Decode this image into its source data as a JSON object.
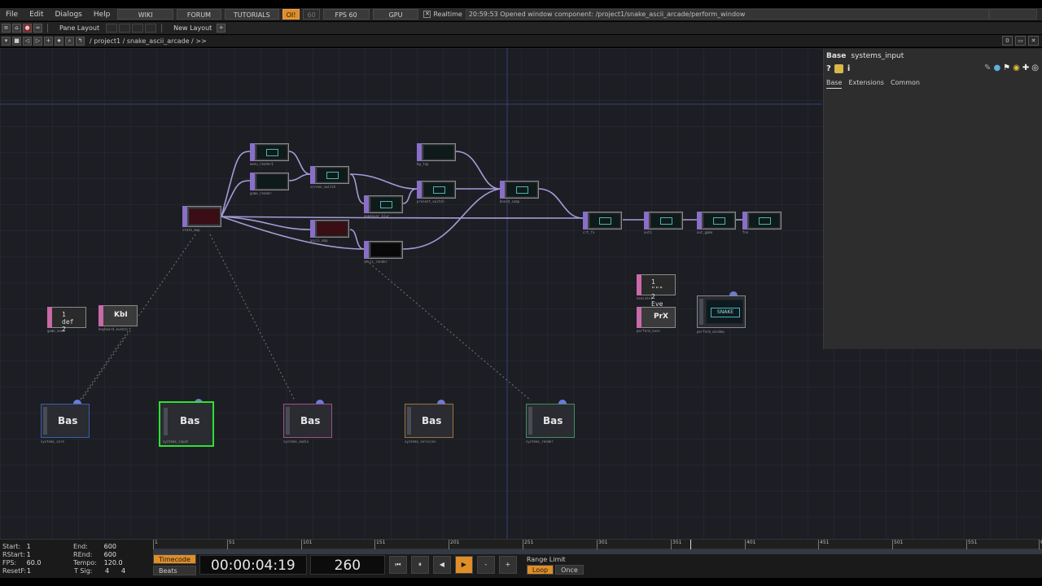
{
  "menu": [
    "File",
    "Edit",
    "Dialogs",
    "Help"
  ],
  "top_buttons": {
    "wiki": "WIKI",
    "forum": "FORUM",
    "tutorials": "TUTORIALS",
    "oi": "OI!",
    "sixty": "60",
    "fps": "FPS  60",
    "gpu": "GPU"
  },
  "realtime": {
    "checked_glyph": "✕",
    "label": "Realtime"
  },
  "status_message": "20:59:53 Opened window component: /project1/snake_ascii_arcade/perform_window",
  "pane": {
    "pane_layout": "Pane Layout",
    "new_layout": "New Layout",
    "plus": "+"
  },
  "path": "/ project1 / snake_ascii_arcade / >>",
  "right_buttons": [
    "0",
    "▭",
    "✕"
  ],
  "nodes": [
    {
      "label": "menu_render1"
    },
    {
      "label": "game_render"
    },
    {
      "label": "screen_switch"
    },
    {
      "label": "gameover_blur"
    },
    {
      "label": "bg_top"
    },
    {
      "label": "present_switch"
    },
    {
      "label": "board_comp"
    },
    {
      "label": "state_map"
    },
    {
      "label": "ascii_map"
    },
    {
      "label": "ascii_render"
    },
    {
      "label": "crt_fx"
    },
    {
      "label": "out1"
    },
    {
      "label": "out_game"
    },
    {
      "label": "fnn"
    }
  ],
  "misc_nodes": {
    "game_exec": {
      "label": "game_exec",
      "line1": "1  def",
      "line2": "2"
    },
    "keyboard": {
      "label": "keyboard_events",
      "title": "KbI"
    },
    "execute1": {
      "label": "execute1",
      "line1": "1  \"\"\"",
      "line2": "2  Eve"
    },
    "perform_exec": {
      "label": "perform_exec",
      "title": "PrX"
    },
    "perform_window": {
      "label": "perform_window",
      "screen_text": "SNAKE"
    }
  },
  "components": [
    {
      "title": "Bas",
      "label": "systems_core",
      "color": "#3a5fb0"
    },
    {
      "title": "Bas",
      "label": "systems_input",
      "color": "#30e030"
    },
    {
      "title": "Bas",
      "label": "systems_audio",
      "color": "#a0508a"
    },
    {
      "title": "Bas",
      "label": "systems_services",
      "color": "#a07040"
    },
    {
      "title": "Bas",
      "label": "systems_render",
      "color": "#409060"
    }
  ],
  "params": {
    "type": "Base",
    "name": "systems_input",
    "help_icon": "?",
    "info_icon": "i",
    "tabs": [
      "Base",
      "Extensions",
      "Common"
    ]
  },
  "timeline": {
    "start_label": "Start:",
    "start": "1",
    "end_label": "End:",
    "end": "600",
    "rstart_label": "RStart:",
    "rstart": "1",
    "rend_label": "REnd:",
    "rend": "600",
    "fps_label": "FPS:",
    "fps": "60.0",
    "tempo_label": "Tempo:",
    "tempo": "120.0",
    "resetf_label": "ResetF:",
    "resetf": "1",
    "tsig_label": "T Sig:",
    "tsig1": "4",
    "tsig2": "4",
    "timecode_chip": "Timecode",
    "beats_chip": "Beats",
    "timecode": "00:00:04:19",
    "frame": "260",
    "range_limit": "Range Limit",
    "loop": "Loop",
    "once": "Once",
    "ticks": [
      "1",
      "51",
      "101",
      "151",
      "201",
      "251",
      "301",
      "351",
      "401",
      "451",
      "501",
      "551",
      "600"
    ],
    "buttons": {
      "begin": "⏮",
      "pause": "⏸",
      "back": "◀",
      "play": "▶",
      "minus": "-",
      "plus": "+"
    }
  }
}
